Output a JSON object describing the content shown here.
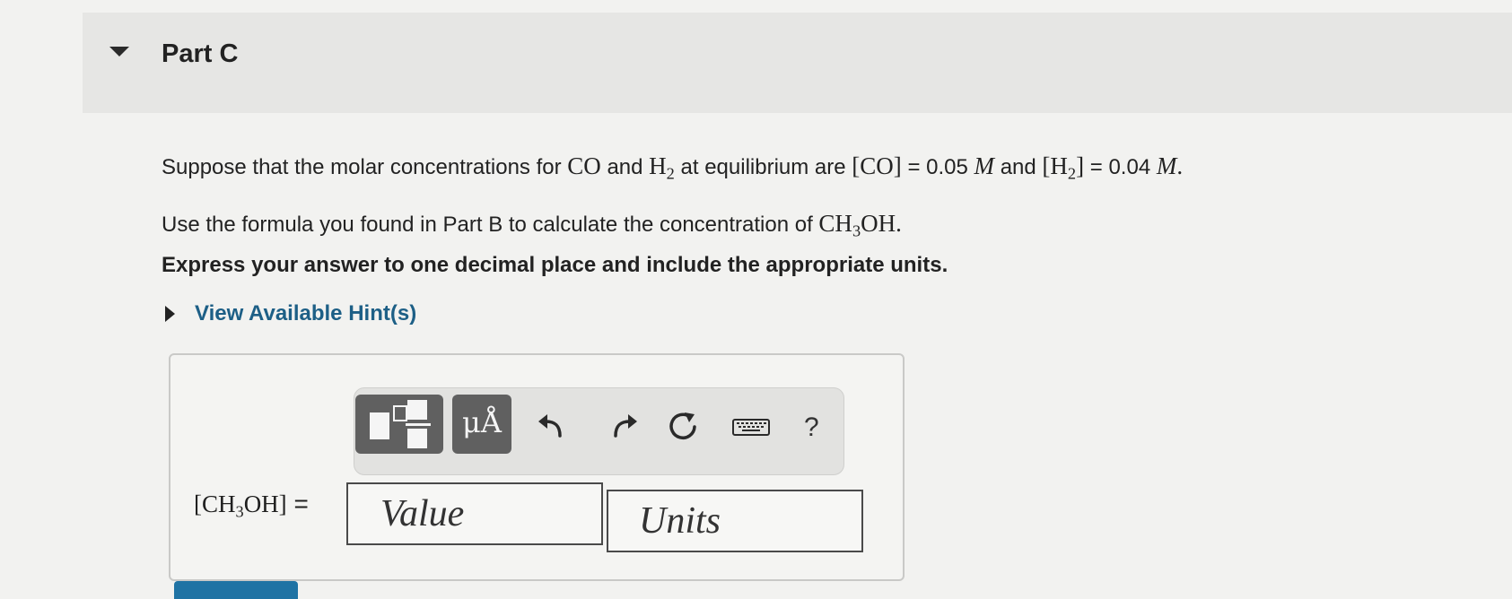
{
  "part": {
    "title": "Part C"
  },
  "question": {
    "line1": {
      "t1": "Suppose that the molar concentrations for ",
      "co": "CO",
      "t2": " and ",
      "h2_base": "H",
      "h2_sub": "2",
      "t3": " at equilibrium are ",
      "co_bracket": "[CO]",
      "t4": " = 0.05 ",
      "m1": "M",
      "t5": " and ",
      "h2b_open": "[H",
      "h2b_sub": "2",
      "h2b_close": "]",
      "t6": " = 0.04 ",
      "m2": "M",
      "t7": "."
    },
    "line2": {
      "t1": "Use the formula you found in Part B to calculate the concentration of ",
      "ch3_base": "CH",
      "ch3_sub": "3",
      "oh": "OH",
      "t2": "."
    },
    "instruction": "Express your answer to one decimal place and include the appropriate units."
  },
  "hint": {
    "label": "View Available Hint(s)"
  },
  "toolbar": {
    "template_icon": "templates-icon",
    "units_label": "μÅ",
    "undo_icon": "undo-icon",
    "redo_icon": "redo-icon",
    "reset_icon": "reset-icon",
    "keyboard_icon": "keyboard-icon",
    "help_label": "?"
  },
  "answer": {
    "label_open": "[CH",
    "label_sub": "3",
    "label_close": "OH]",
    "label_eq": " =",
    "value_placeholder": "Value",
    "units_placeholder": "Units"
  },
  "colors": {
    "link": "#1d5f86",
    "submit": "#1f73a4",
    "toolbar_button": "#606060"
  }
}
